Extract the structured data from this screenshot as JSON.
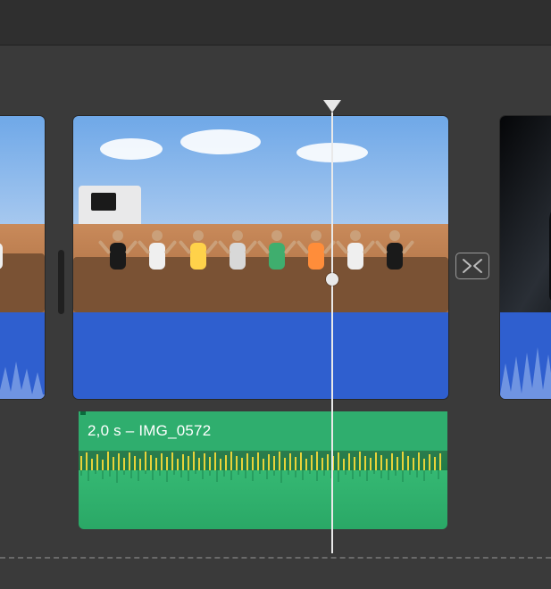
{
  "colors": {
    "background": "#3a3a3a",
    "video_audio_band": "#2f5fcf",
    "audio_track": "#2fae6e",
    "playhead": "#e9e9e9"
  },
  "playhead": {
    "position_fraction": 0.69
  },
  "clips": {
    "left": {
      "type": "video",
      "name": "previous-clip"
    },
    "main": {
      "type": "video",
      "name": "main-clip"
    },
    "right": {
      "type": "video",
      "name": "next-clip"
    }
  },
  "transition": {
    "icon": "transition-icon"
  },
  "audio_track": {
    "duration_label": "2,0 s",
    "separator": " – ",
    "filename": "IMG_0572"
  }
}
